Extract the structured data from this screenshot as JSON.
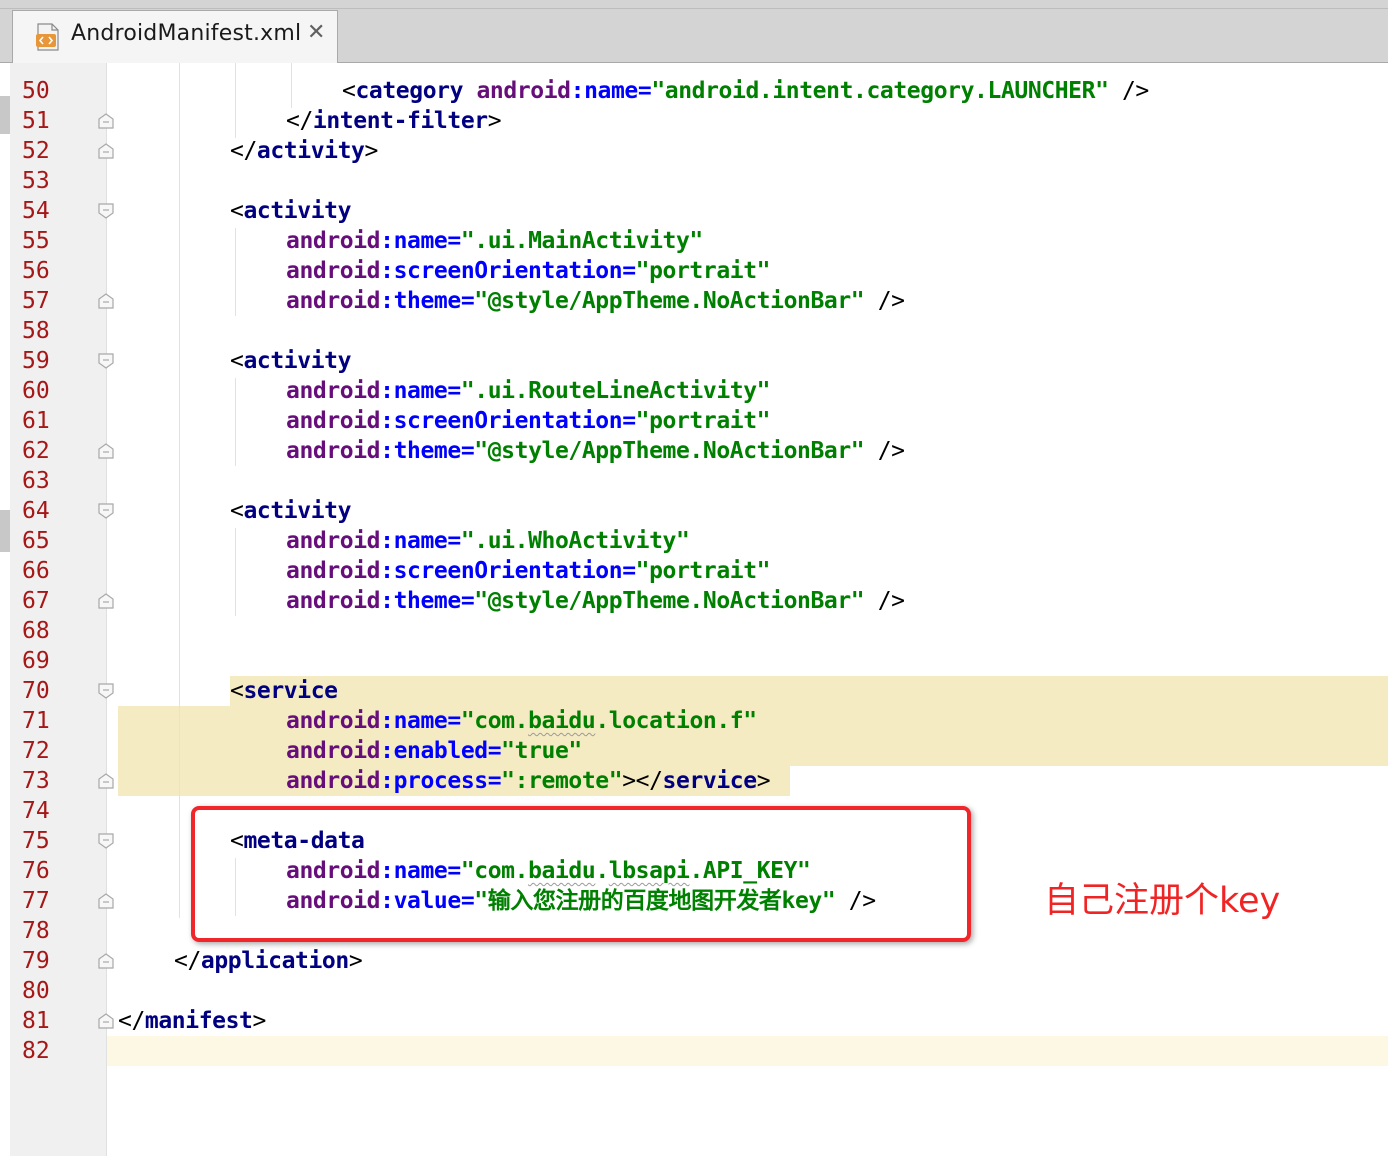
{
  "tab": {
    "filename": "AndroidManifest.xml",
    "icon": "xml-file-icon",
    "close_glyph": "✕"
  },
  "lines": [
    {
      "num": "50",
      "tokens": [
        {
          "t": "pn",
          "s": "<"
        },
        {
          "t": "tg",
          "s": "category"
        },
        {
          "t": "pn",
          "s": " "
        },
        {
          "t": "ns",
          "s": "android"
        },
        {
          "t": "at",
          "s": ":name="
        },
        {
          "t": "vl",
          "s": "\"android.intent.category.LAUNCHER\""
        },
        {
          "t": "pn",
          "s": " />"
        }
      ]
    },
    {
      "num": "51",
      "tokens": [
        {
          "t": "pn",
          "s": "</"
        },
        {
          "t": "tg",
          "s": "intent-filter"
        },
        {
          "t": "pn",
          "s": ">"
        }
      ]
    },
    {
      "num": "52",
      "tokens": [
        {
          "t": "pn",
          "s": "</"
        },
        {
          "t": "tg",
          "s": "activity"
        },
        {
          "t": "pn",
          "s": ">"
        }
      ]
    },
    {
      "num": "53",
      "tokens": []
    },
    {
      "num": "54",
      "tokens": [
        {
          "t": "pn",
          "s": "<"
        },
        {
          "t": "tg",
          "s": "activity"
        }
      ]
    },
    {
      "num": "55",
      "tokens": [
        {
          "t": "ns",
          "s": "android"
        },
        {
          "t": "at",
          "s": ":name="
        },
        {
          "t": "vl",
          "s": "\".ui.MainActivity\""
        }
      ]
    },
    {
      "num": "56",
      "tokens": [
        {
          "t": "ns",
          "s": "android"
        },
        {
          "t": "at",
          "s": ":screenOrientation="
        },
        {
          "t": "vl",
          "s": "\"portrait\""
        }
      ]
    },
    {
      "num": "57",
      "tokens": [
        {
          "t": "ns",
          "s": "android"
        },
        {
          "t": "at",
          "s": ":theme="
        },
        {
          "t": "vl",
          "s": "\"@style/AppTheme.NoActionBar\""
        },
        {
          "t": "pn",
          "s": " />"
        }
      ]
    },
    {
      "num": "58",
      "tokens": []
    },
    {
      "num": "59",
      "tokens": [
        {
          "t": "pn",
          "s": "<"
        },
        {
          "t": "tg",
          "s": "activity"
        }
      ]
    },
    {
      "num": "60",
      "tokens": [
        {
          "t": "ns",
          "s": "android"
        },
        {
          "t": "at",
          "s": ":name="
        },
        {
          "t": "vl",
          "s": "\".ui.RouteLineActivity\""
        }
      ]
    },
    {
      "num": "61",
      "tokens": [
        {
          "t": "ns",
          "s": "android"
        },
        {
          "t": "at",
          "s": ":screenOrientation="
        },
        {
          "t": "vl",
          "s": "\"portrait\""
        }
      ]
    },
    {
      "num": "62",
      "tokens": [
        {
          "t": "ns",
          "s": "android"
        },
        {
          "t": "at",
          "s": ":theme="
        },
        {
          "t": "vl",
          "s": "\"@style/AppTheme.NoActionBar\""
        },
        {
          "t": "pn",
          "s": " />"
        }
      ]
    },
    {
      "num": "63",
      "tokens": []
    },
    {
      "num": "64",
      "tokens": [
        {
          "t": "pn",
          "s": "<"
        },
        {
          "t": "tg",
          "s": "activity"
        }
      ]
    },
    {
      "num": "65",
      "tokens": [
        {
          "t": "ns",
          "s": "android"
        },
        {
          "t": "at",
          "s": ":name="
        },
        {
          "t": "vl",
          "s": "\".ui.WhoActivity\""
        }
      ]
    },
    {
      "num": "66",
      "tokens": [
        {
          "t": "ns",
          "s": "android"
        },
        {
          "t": "at",
          "s": ":screenOrientation="
        },
        {
          "t": "vl",
          "s": "\"portrait\""
        }
      ]
    },
    {
      "num": "67",
      "tokens": [
        {
          "t": "ns",
          "s": "android"
        },
        {
          "t": "at",
          "s": ":theme="
        },
        {
          "t": "vl",
          "s": "\"@style/AppTheme.NoActionBar\""
        },
        {
          "t": "pn",
          "s": " />"
        }
      ]
    },
    {
      "num": "68",
      "tokens": []
    },
    {
      "num": "69",
      "tokens": []
    },
    {
      "num": "70",
      "tokens": [
        {
          "t": "pn",
          "s": "<"
        },
        {
          "t": "tg",
          "s": "service"
        }
      ]
    },
    {
      "num": "71",
      "tokens": [
        {
          "t": "ns",
          "s": "android"
        },
        {
          "t": "at",
          "s": ":name="
        },
        {
          "t": "vl",
          "s": "\"com."
        },
        {
          "t": "vl wavy",
          "s": "baidu"
        },
        {
          "t": "vl",
          "s": ".location.f\""
        }
      ]
    },
    {
      "num": "72",
      "tokens": [
        {
          "t": "ns",
          "s": "android"
        },
        {
          "t": "at",
          "s": ":enabled="
        },
        {
          "t": "vl",
          "s": "\"true\""
        }
      ]
    },
    {
      "num": "73",
      "tokens": [
        {
          "t": "ns",
          "s": "android"
        },
        {
          "t": "at",
          "s": ":process="
        },
        {
          "t": "vl",
          "s": "\":remote\""
        },
        {
          "t": "pn",
          "s": "></"
        },
        {
          "t": "tg",
          "s": "service"
        },
        {
          "t": "pn",
          "s": ">"
        }
      ]
    },
    {
      "num": "74",
      "tokens": []
    },
    {
      "num": "75",
      "tokens": [
        {
          "t": "pn",
          "s": "<"
        },
        {
          "t": "tg",
          "s": "meta-data"
        }
      ]
    },
    {
      "num": "76",
      "tokens": [
        {
          "t": "ns",
          "s": "android"
        },
        {
          "t": "at",
          "s": ":name="
        },
        {
          "t": "vl",
          "s": "\"com."
        },
        {
          "t": "vl wavy",
          "s": "baidu"
        },
        {
          "t": "vl",
          "s": "."
        },
        {
          "t": "vl wavy",
          "s": "lbsapi"
        },
        {
          "t": "vl",
          "s": ".API_KEY\""
        }
      ]
    },
    {
      "num": "77",
      "tokens": [
        {
          "t": "ns",
          "s": "android"
        },
        {
          "t": "at",
          "s": ":value="
        },
        {
          "t": "vl",
          "s": "\"输入您注册的百度地图开发者key\""
        },
        {
          "t": "pn",
          "s": " />"
        }
      ]
    },
    {
      "num": "78",
      "tokens": []
    },
    {
      "num": "79",
      "tokens": [
        {
          "t": "pn",
          "s": "</"
        },
        {
          "t": "tg",
          "s": "application"
        },
        {
          "t": "pn",
          "s": ">"
        }
      ]
    },
    {
      "num": "80",
      "tokens": []
    },
    {
      "num": "81",
      "tokens": [
        {
          "t": "pn",
          "s": "</"
        },
        {
          "t": "tg",
          "s": "manifest"
        },
        {
          "t": "pn",
          "s": ">"
        }
      ]
    },
    {
      "num": "82",
      "tokens": []
    }
  ],
  "annotation": {
    "text": "自己注册个key",
    "color": "#f02424"
  },
  "colors": {
    "tag": "#000080",
    "namespace": "#660e7a",
    "attribute": "#0000ff",
    "value": "#008000",
    "line_number": "#a61717",
    "highlight": "#f5ebc2",
    "red_box": "#f0262a"
  }
}
